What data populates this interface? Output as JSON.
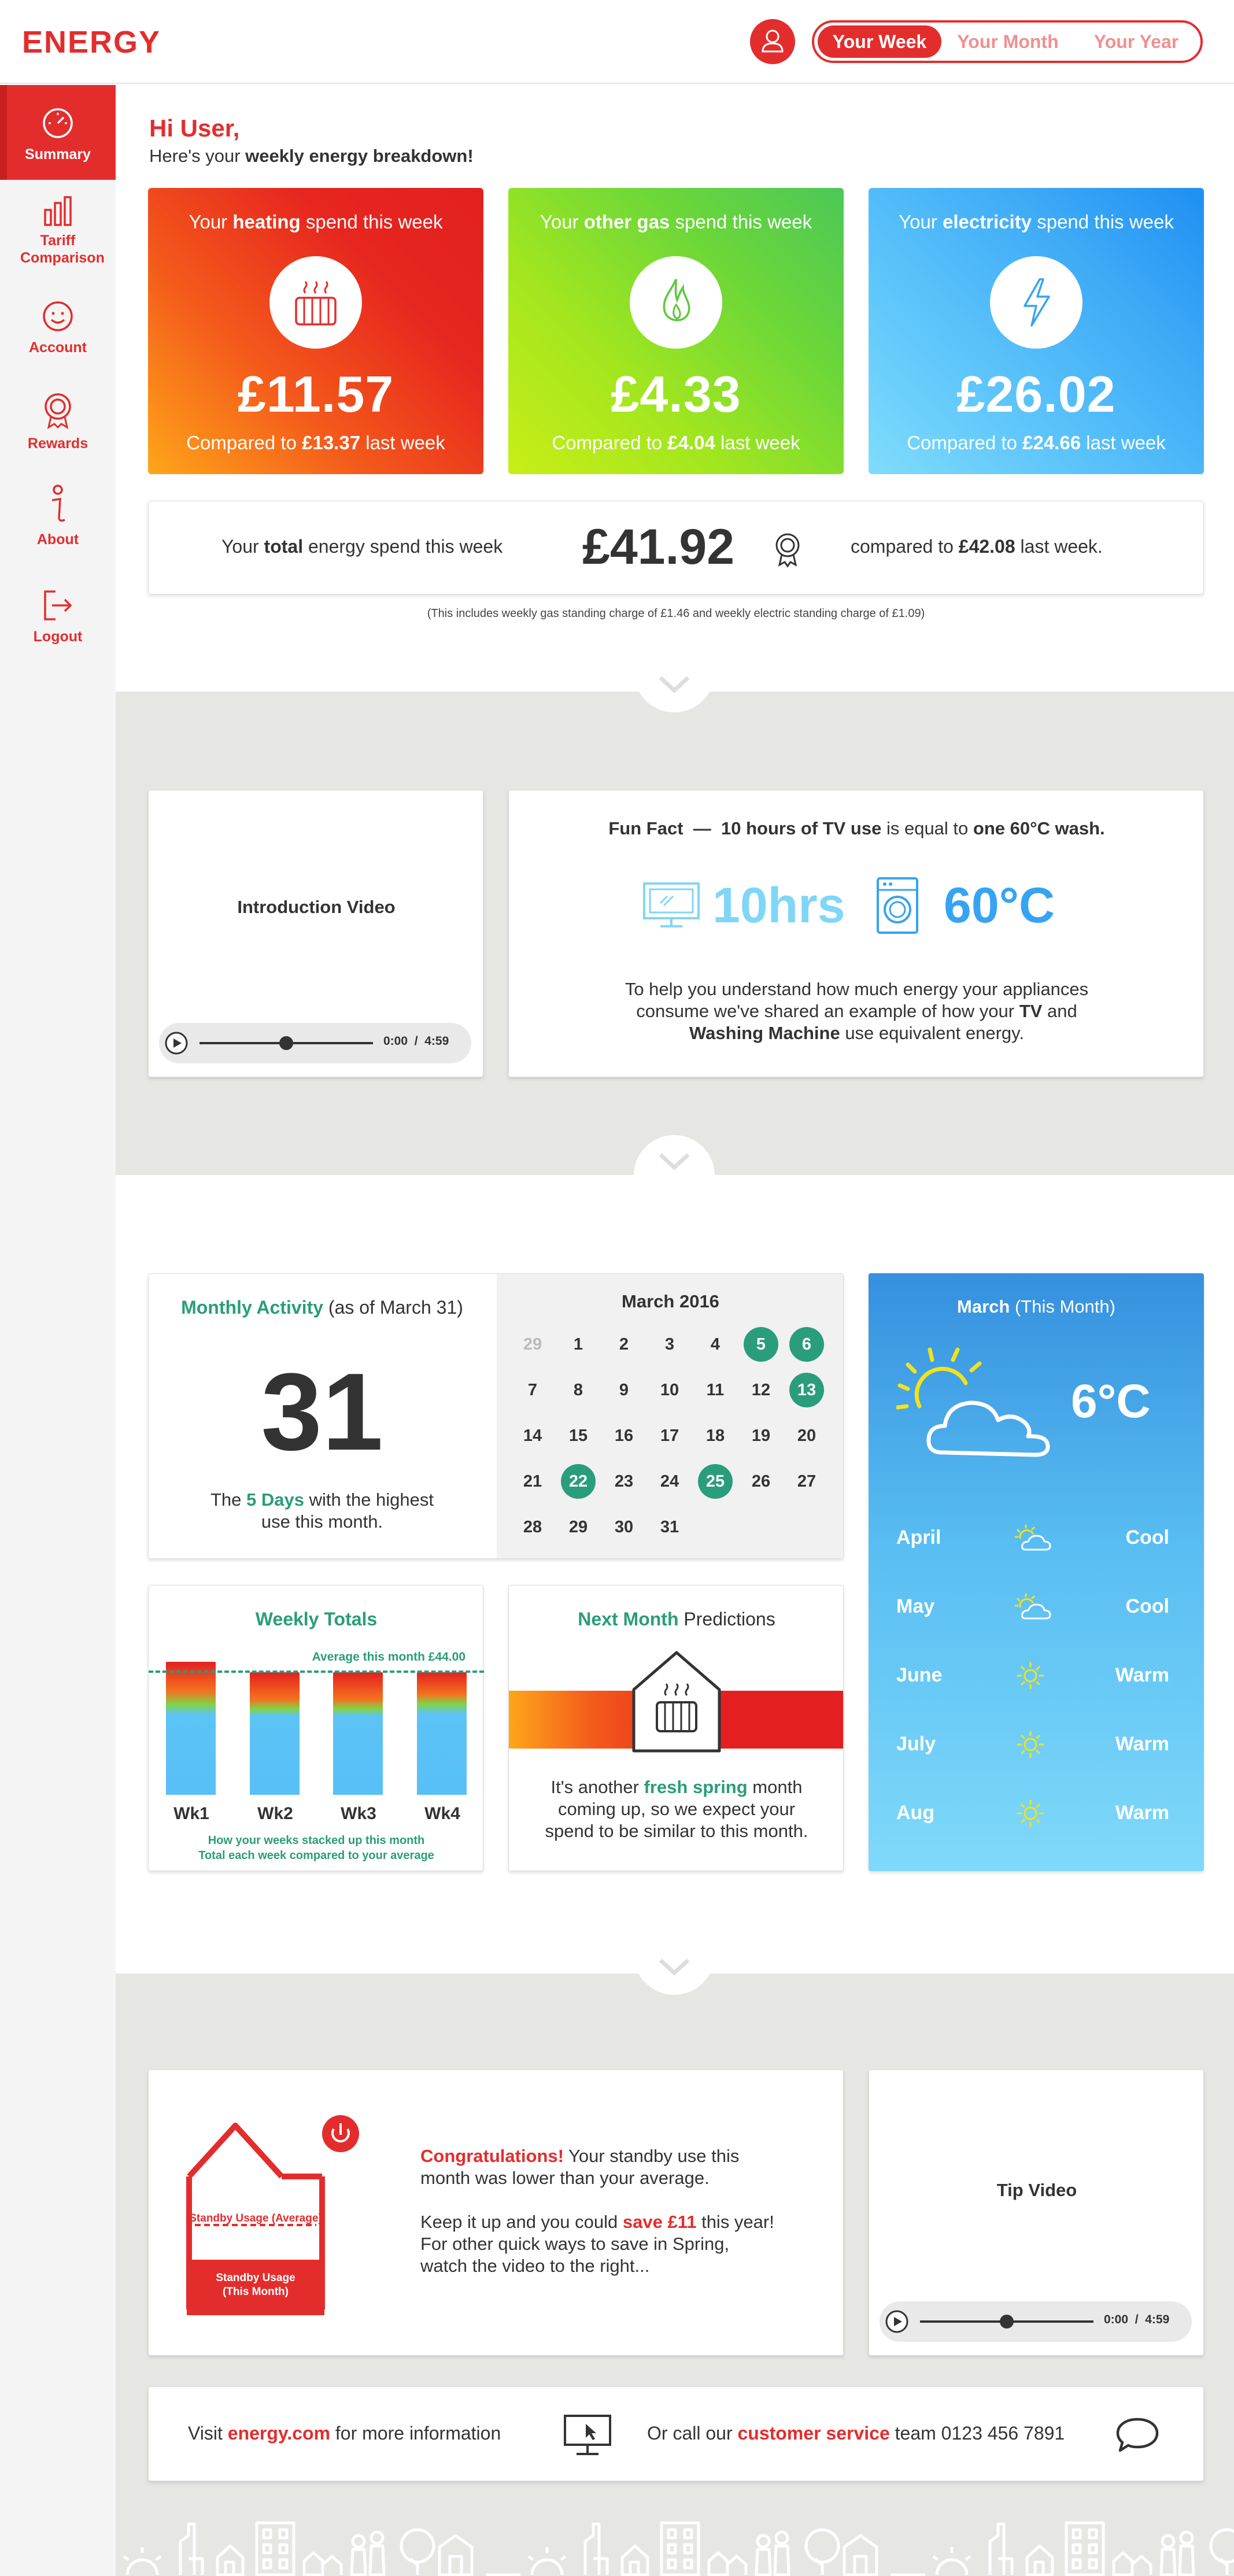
{
  "header": {
    "logo": "ENERGY",
    "periods": [
      "Your Week",
      "Your Month",
      "Your Year"
    ],
    "active_period": "Your Week"
  },
  "sidebar": {
    "items": [
      {
        "label": "Summary",
        "icon": "gauge-icon",
        "active": true
      },
      {
        "label": "Tariff Comparison",
        "icon": "bar-chart-icon"
      },
      {
        "label": "Account",
        "icon": "smiley-icon"
      },
      {
        "label": "Rewards",
        "icon": "award-icon"
      },
      {
        "label": "About",
        "icon": "info-icon"
      },
      {
        "label": "Logout",
        "icon": "logout-icon"
      }
    ]
  },
  "greeting": {
    "title": "Hi User,",
    "subtitle_prefix": "Here's your ",
    "subtitle_bold": "weekly energy breakdown!"
  },
  "spend_cards": [
    {
      "pre": "Your ",
      "bold": "heating",
      "post": " spend this week",
      "amount": "£11.57",
      "cmp_pre": "Compared to ",
      "cmp_bold": "£13.37",
      "cmp_post": " last week",
      "icon": "radiator-icon"
    },
    {
      "pre": "Your ",
      "bold": "other gas",
      "post": " spend this week",
      "amount": "£4.33",
      "cmp_pre": "Compared to ",
      "cmp_bold": "£4.04",
      "cmp_post": " last week",
      "icon": "flame-icon"
    },
    {
      "pre": "Your ",
      "bold": "electricity",
      "post": " spend this week",
      "amount": "£26.02",
      "cmp_pre": "Compared to ",
      "cmp_bold": "£24.66",
      "cmp_post": " last week",
      "icon": "lightning-icon"
    }
  ],
  "total": {
    "pre": "Your ",
    "bold": "total",
    "post": " energy spend this week",
    "amount": "£41.92",
    "cmp_pre": "compared to ",
    "cmp_bold": "£42.08",
    "cmp_post": " last week.",
    "note": "(This includes weekly gas standing charge of £1.46 and weekly electric standing charge of £1.09)"
  },
  "intro_video": {
    "title": "Introduction Video",
    "time": "0:00",
    "duration": "4:59",
    "sep": "/"
  },
  "fun_fact": {
    "label": "Fun Fact",
    "dash": "—",
    "bold1": "10 hours of TV use",
    "mid": " is equal to ",
    "bold2": "one 60°C wash.",
    "big1": "10hrs",
    "big2": "60°C",
    "body1": "To help you understand how much energy your appliances",
    "body2": "consume we've shared an example of how your ",
    "body2_bold": "TV",
    "body2_post": " and",
    "body3_bold": "Washing Machine",
    "body3": " use equivalent energy."
  },
  "monthly": {
    "title_bold": "Monthly Activity",
    "title_rest": " (as of March 31)",
    "big": "31",
    "desc_pre": "The ",
    "desc_bold": "5 Days",
    "desc_post": " with the highest",
    "desc_line2": "use this month."
  },
  "calendar": {
    "title": "March 2016",
    "days": [
      "29",
      "1",
      "2",
      "3",
      "4",
      "5",
      "6",
      "7",
      "8",
      "9",
      "10",
      "11",
      "12",
      "13",
      "14",
      "15",
      "16",
      "17",
      "18",
      "19",
      "20",
      "21",
      "22",
      "23",
      "24",
      "25",
      "26",
      "27",
      "28",
      "29",
      "30",
      "31"
    ],
    "highlighted": [
      "5",
      "6",
      "13",
      "22",
      "25"
    ]
  },
  "weather": {
    "title_bold": "March",
    "title_rest": " (This Month)",
    "temp": "6°C",
    "rows": [
      {
        "month": "April",
        "desc": "Cool",
        "icon": "sun-cloud-icon"
      },
      {
        "month": "May",
        "desc": "Cool",
        "icon": "sun-cloud-icon"
      },
      {
        "month": "June",
        "desc": "Warm",
        "icon": "sun-icon"
      },
      {
        "month": "July",
        "desc": "Warm",
        "icon": "sun-icon"
      },
      {
        "month": "Aug",
        "desc": "Warm",
        "icon": "sun-icon"
      }
    ]
  },
  "weekly_totals": {
    "title": "Weekly Totals",
    "avg_label": "Average this month £44.00",
    "weeks": [
      "Wk1",
      "Wk2",
      "Wk3",
      "Wk4"
    ],
    "caption1": "How your weeks stacked up this month",
    "caption2": "Total each week compared to your average"
  },
  "predictions": {
    "title_bold": "Next Month",
    "title_rest": " Predictions",
    "line1_pre": "It's another ",
    "line1_bold": "fresh spring",
    "line1_post": " month",
    "line2": "coming up, so we expect your",
    "line3": "spend to be similar to this month."
  },
  "standby": {
    "avg_label": "Standby Usage (Average)",
    "month_label1": "Standby Usage",
    "month_label2": "(This Month)",
    "congrats": "Congratulations!",
    "line1_post": " Your standby use this",
    "line2": "month was lower than your average.",
    "line3_pre": "Keep it up and you could ",
    "line3_bold": "save £11",
    "line3_post": " this year!",
    "line4": "For other quick ways to save in Spring,",
    "line5": "watch the video to the right..."
  },
  "tip_video": {
    "title": "Tip Video",
    "time": "0:00",
    "duration": "4:59",
    "sep": "/"
  },
  "footer": {
    "visit_pre": "Visit ",
    "visit_link": "energy.com",
    "visit_post": " for more information",
    "call_pre": "Or call our ",
    "call_link": "customer service",
    "call_post": " team 0123 456 7891"
  }
}
